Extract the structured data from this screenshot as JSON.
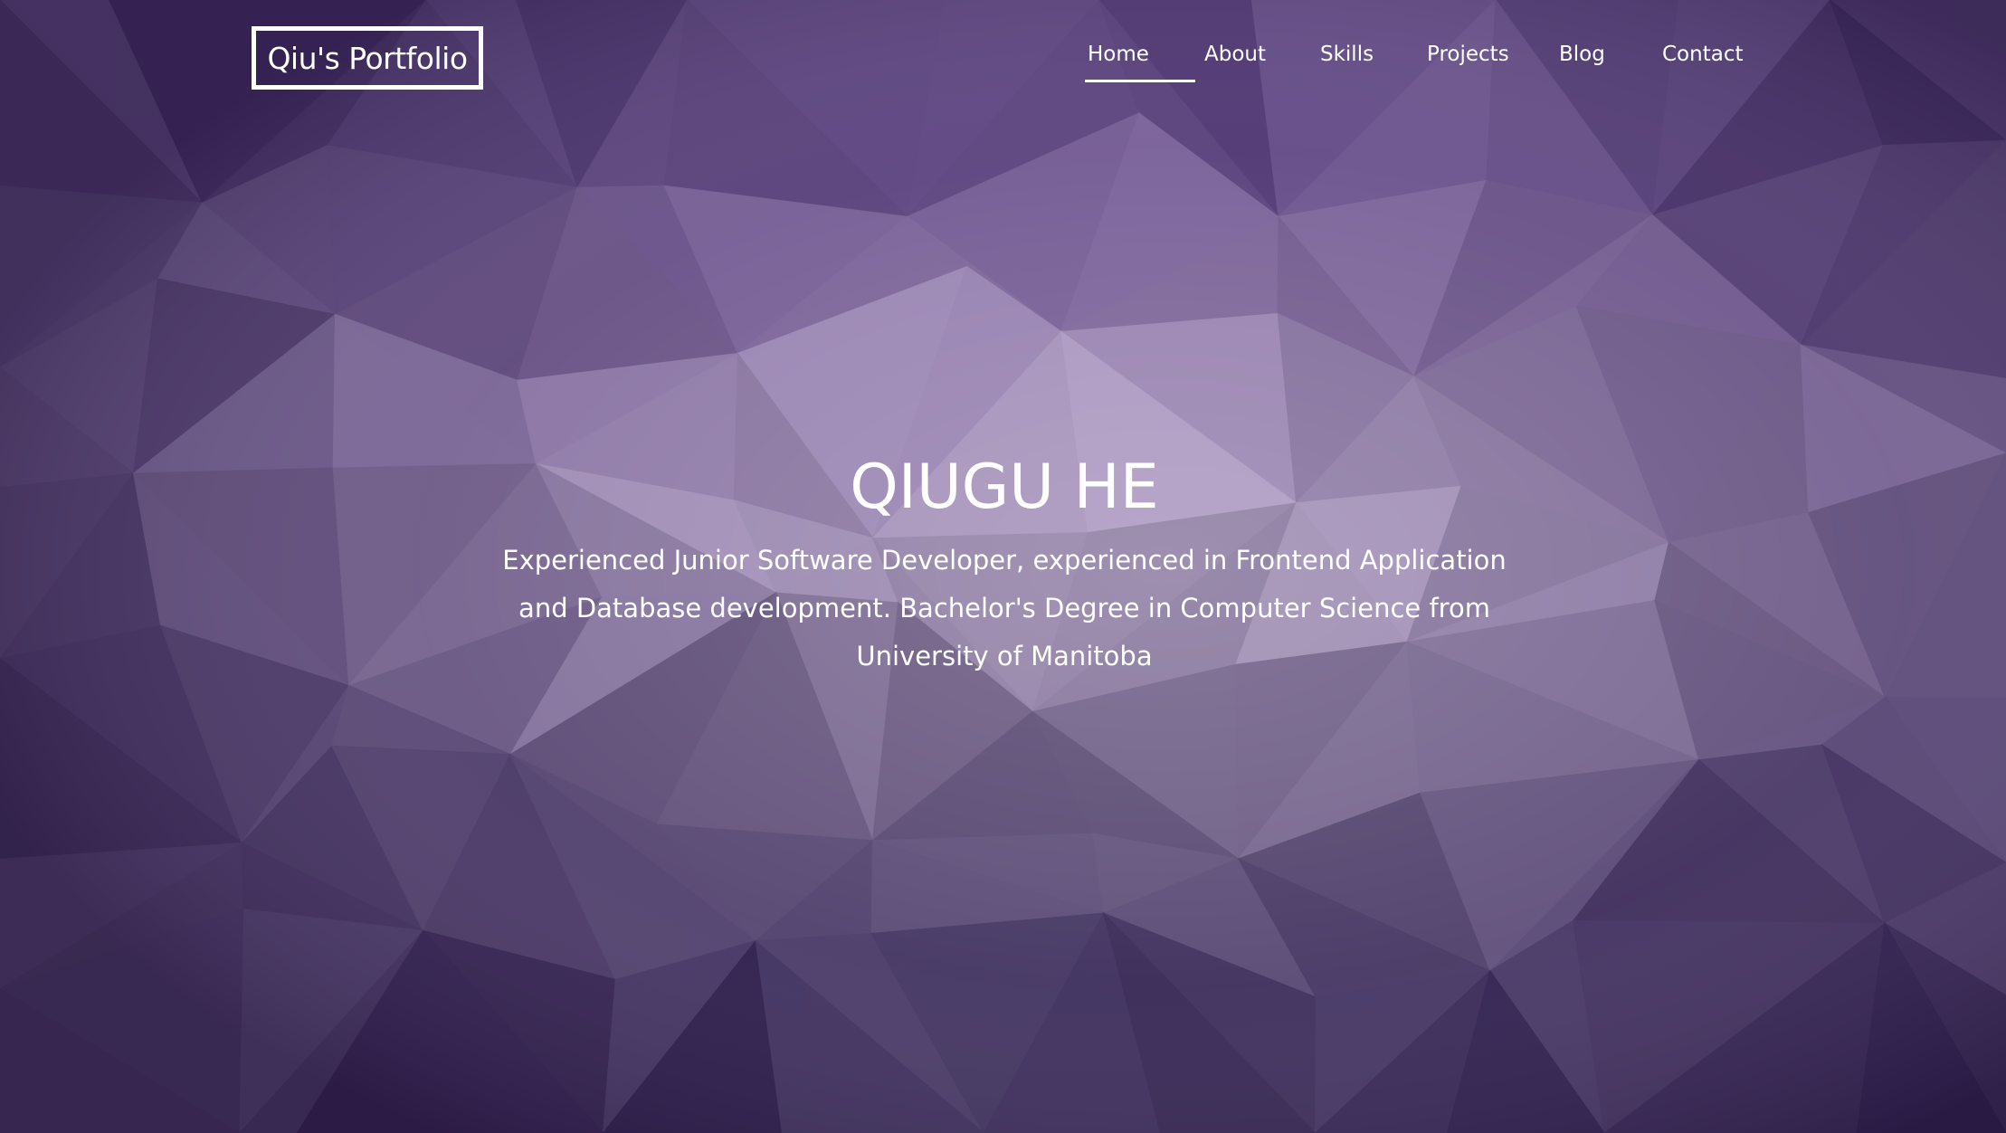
{
  "logo": {
    "text": "Qiu's Portfolio"
  },
  "nav": {
    "items": [
      {
        "label": "Home",
        "active": true
      },
      {
        "label": "About",
        "active": false
      },
      {
        "label": "Skills",
        "active": false
      },
      {
        "label": "Projects",
        "active": false
      },
      {
        "label": "Blog",
        "active": false
      },
      {
        "label": "Contact",
        "active": false
      }
    ]
  },
  "hero": {
    "title": "QIUGU HE",
    "description": "Experienced Junior Software Developer, experienced in Frontend Application and Database development. Bachelor's Degree in Computer Science from University of Manitoba"
  },
  "colors": {
    "text": "#ffffff",
    "background_top": "#5f4488",
    "background_center": "#a48fb8",
    "background_bottom": "#2c2448"
  }
}
